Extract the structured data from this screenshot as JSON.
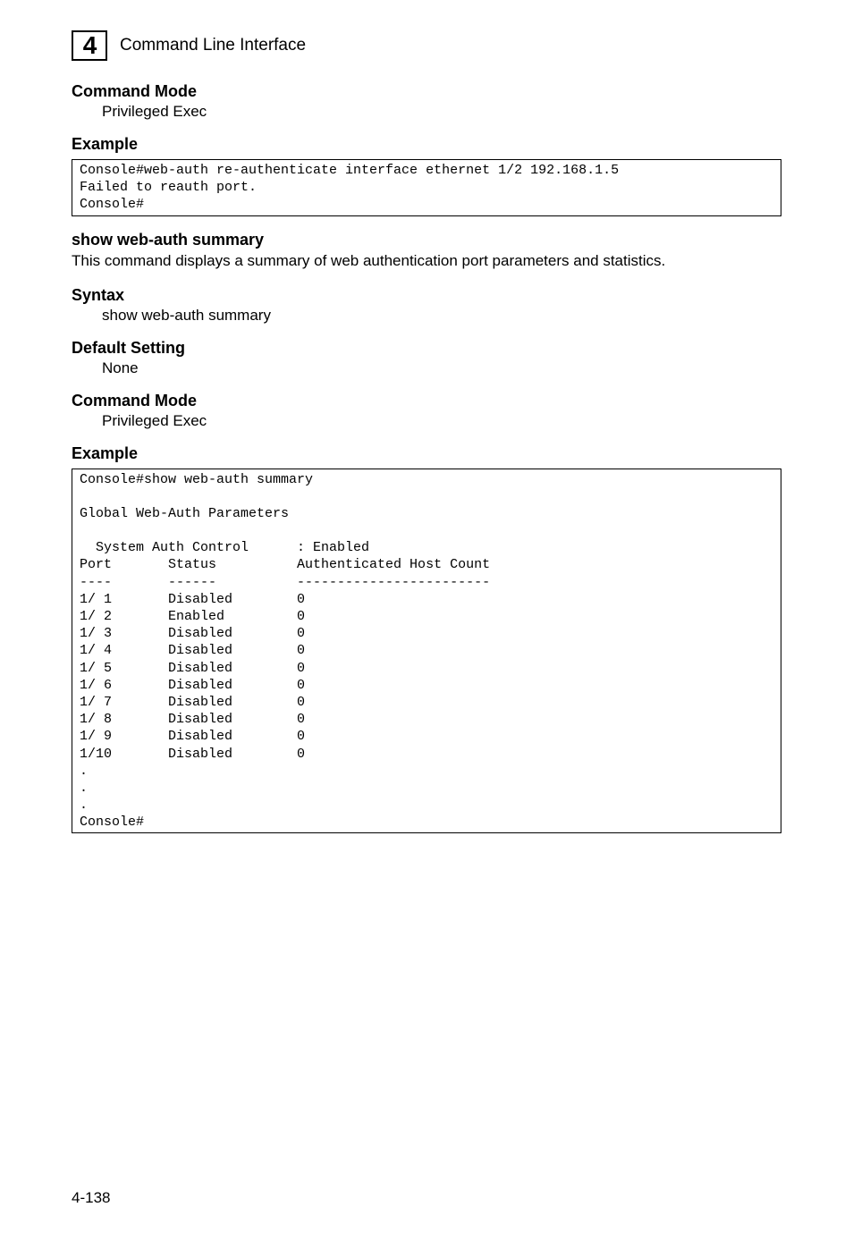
{
  "header": {
    "chapter_number": "4",
    "chapter_title": "Command Line Interface"
  },
  "sections": {
    "command_mode_1": {
      "heading": "Command Mode",
      "value": "Privileged Exec"
    },
    "example_1": {
      "heading": "Example",
      "code": "Console#web-auth re-authenticate interface ethernet 1/2 192.168.1.5\nFailed to reauth port.\nConsole#"
    },
    "show_web_auth": {
      "heading": "show web-auth summary",
      "description": "This command displays a summary of web authentication port parameters and statistics."
    },
    "syntax": {
      "heading": "Syntax",
      "value": "show web-auth summary"
    },
    "default_setting": {
      "heading": "Default Setting",
      "value": "None"
    },
    "command_mode_2": {
      "heading": "Command Mode",
      "value": "Privileged Exec"
    },
    "example_2": {
      "heading": "Example",
      "code": "Console#show web-auth summary\n\nGlobal Web-Auth Parameters\n\n  System Auth Control      : Enabled\nPort       Status          Authenticated Host Count\n----       ------          ------------------------\n1/ 1       Disabled        0\n1/ 2       Enabled         0\n1/ 3       Disabled        0\n1/ 4       Disabled        0\n1/ 5       Disabled        0\n1/ 6       Disabled        0\n1/ 7       Disabled        0\n1/ 8       Disabled        0\n1/ 9       Disabled        0\n1/10       Disabled        0\n.\n.\n.\nConsole#"
    }
  },
  "footer": {
    "page_number": "4-138"
  }
}
